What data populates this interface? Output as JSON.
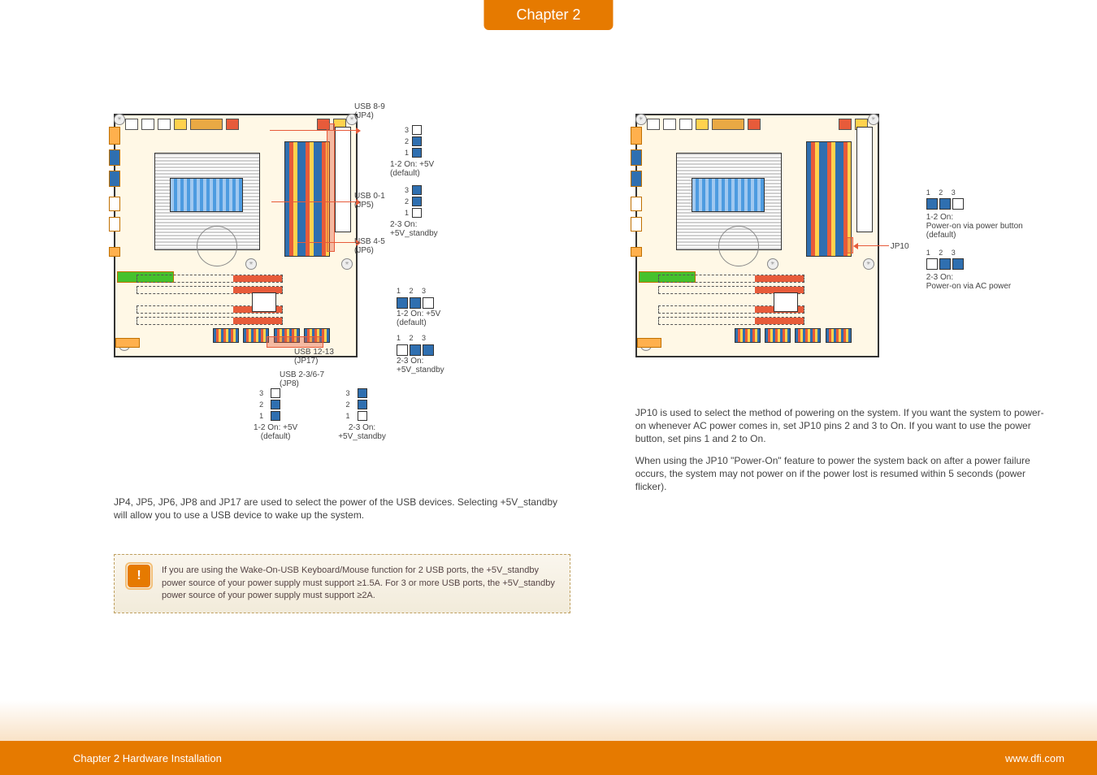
{
  "chapter_tab": "Chapter 2",
  "left": {
    "labels": {
      "usb89": "USB 8-9\n(JP4)",
      "usb01": "USB 0-1\n(JP5)",
      "usb45": "USB 4-5\n(JP6)",
      "usb1213": "USB 12-13\n(JP17)",
      "usb2367": "USB 2-3/6-7\n(JP8)"
    },
    "pins_v": {
      "nums": [
        "3",
        "2",
        "1"
      ]
    },
    "pins_h": {
      "nums": "1  2  3"
    },
    "text_12on": "1-2 On: +5V\n(default)",
    "text_23on": "2-3 On:\n+5V_standby",
    "para1": "JP4, JP5, JP6, JP8 and JP17 are used to select the power of the USB devices. Selecting +5V_standby will allow you to use a USB device to wake up the system.",
    "important": "If you are using the Wake-On-USB Keyboard/Mouse function for 2 USB ports, the +5V_standby power source of your power supply must support ≥1.5A. For 3 or more USB ports, the +5V_standby power source of your power supply must support ≥2A."
  },
  "right": {
    "jp10_label": "JP10",
    "pins_h": {
      "nums": "1  2  3"
    },
    "opt1": "1-2 On:\nPower-on via power button\n(default)",
    "opt2": "2-3 On:\nPower-on via AC power",
    "para1": "JP10 is used to select the method of powering on the system. If you want the system to power-on whenever AC power comes in, set JP10 pins 2 and 3 to On. If you want to use the power button, set pins 1 and 2 to On.",
    "para2": "When using the JP10 \"Power-On\" feature to power the system back on after a power failure occurs, the system may not power on if the power lost is resumed within 5 seconds (power flicker)."
  },
  "footer": {
    "left": "Chapter 2 Hardware Installation",
    "right": "www.dfi.com"
  }
}
